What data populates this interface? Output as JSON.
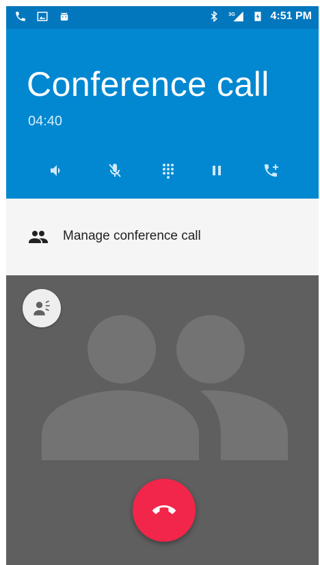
{
  "status_bar": {
    "time": "4:51 PM",
    "network": "3G",
    "left_icons": [
      "phone-icon",
      "image-icon",
      "android-icon"
    ],
    "right_icons": [
      "bluetooth-icon",
      "signal-icon",
      "battery-charging-icon"
    ]
  },
  "call": {
    "title": "Conference call",
    "timer": "04:40"
  },
  "controls": [
    {
      "name": "speaker",
      "icon": "speaker-icon"
    },
    {
      "name": "mute",
      "icon": "mic-off-icon"
    },
    {
      "name": "dialpad",
      "icon": "dialpad-icon"
    },
    {
      "name": "hold",
      "icon": "pause-icon"
    },
    {
      "name": "add-call",
      "icon": "add-call-icon"
    }
  ],
  "manage": {
    "label": "Manage conference call",
    "icon": "people-icon"
  },
  "colors": {
    "status_bar": "#0277bd",
    "header": "#0288d1",
    "end_call": "#f2264a",
    "photo_bg": "#5f5f5f"
  }
}
